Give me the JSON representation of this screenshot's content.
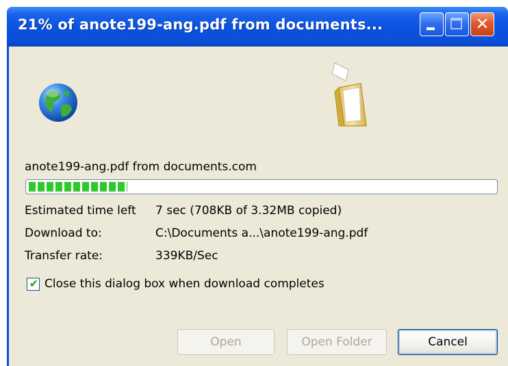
{
  "window": {
    "title": "21% of anote199-ang.pdf from documents...",
    "minimize_icon": "minimize-icon",
    "maximize_icon": "maximize-icon",
    "close_icon": "close-icon",
    "close_glyph": "✕"
  },
  "download": {
    "source_icon": "globe-icon",
    "target_icon": "folder-icon",
    "file_source": "anote199-ang.pdf from documents.com",
    "progress_percent": 21,
    "estimated_label": "Estimated time left",
    "estimated_value": "7 sec (708KB of 3.32MB copied)",
    "download_to_label": "Download to:",
    "download_to_value": "C:\\Documents a...\\anote199-ang.pdf",
    "rate_label": "Transfer rate:",
    "rate_value": "339KB/Sec",
    "close_when_done_label": "Close this dialog box when download completes",
    "close_when_done_checked": true
  },
  "buttons": {
    "open": "Open",
    "open_folder": "Open Folder",
    "cancel": "Cancel"
  },
  "colors": {
    "titlebar": "#0a4fd8",
    "client": "#ece9d8",
    "progress_green": "#2fc82f",
    "close_button": "#e05a2c"
  }
}
